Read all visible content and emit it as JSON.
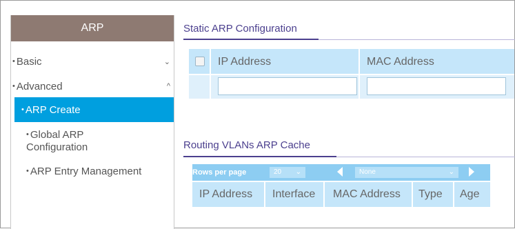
{
  "sidebar": {
    "header": "ARP",
    "items": [
      {
        "bullet": "•",
        "label": "Basic",
        "chevron": "⌄"
      },
      {
        "bullet": "•",
        "label": "Advanced",
        "chevron": "^"
      },
      {
        "bullet": "•",
        "label": "ARP Create"
      },
      {
        "bullet": "•",
        "label": "Global ARP",
        "label2": "Configuration"
      },
      {
        "bullet": "•",
        "label": "ARP Entry Management"
      }
    ]
  },
  "static_arp": {
    "title": "Static ARP Configuration",
    "columns": [
      "IP Address",
      "MAC Address"
    ],
    "ip_value": "",
    "mac_value": ""
  },
  "routing_cache": {
    "title": "Routing VLANs ARP Cache",
    "rows_per_page_label": "Rows per page",
    "rows_per_page_value": "20",
    "filter_value": "None",
    "columns": [
      "IP Address",
      "Interface",
      "MAC Address",
      "Type",
      "Age"
    ]
  },
  "colors": {
    "sidebar_header": "#8e7a72",
    "active_item": "#009fdf",
    "title": "#4b3f8e",
    "table_header": "#c5e6fa",
    "cache_bar": "#8dcdf2"
  }
}
